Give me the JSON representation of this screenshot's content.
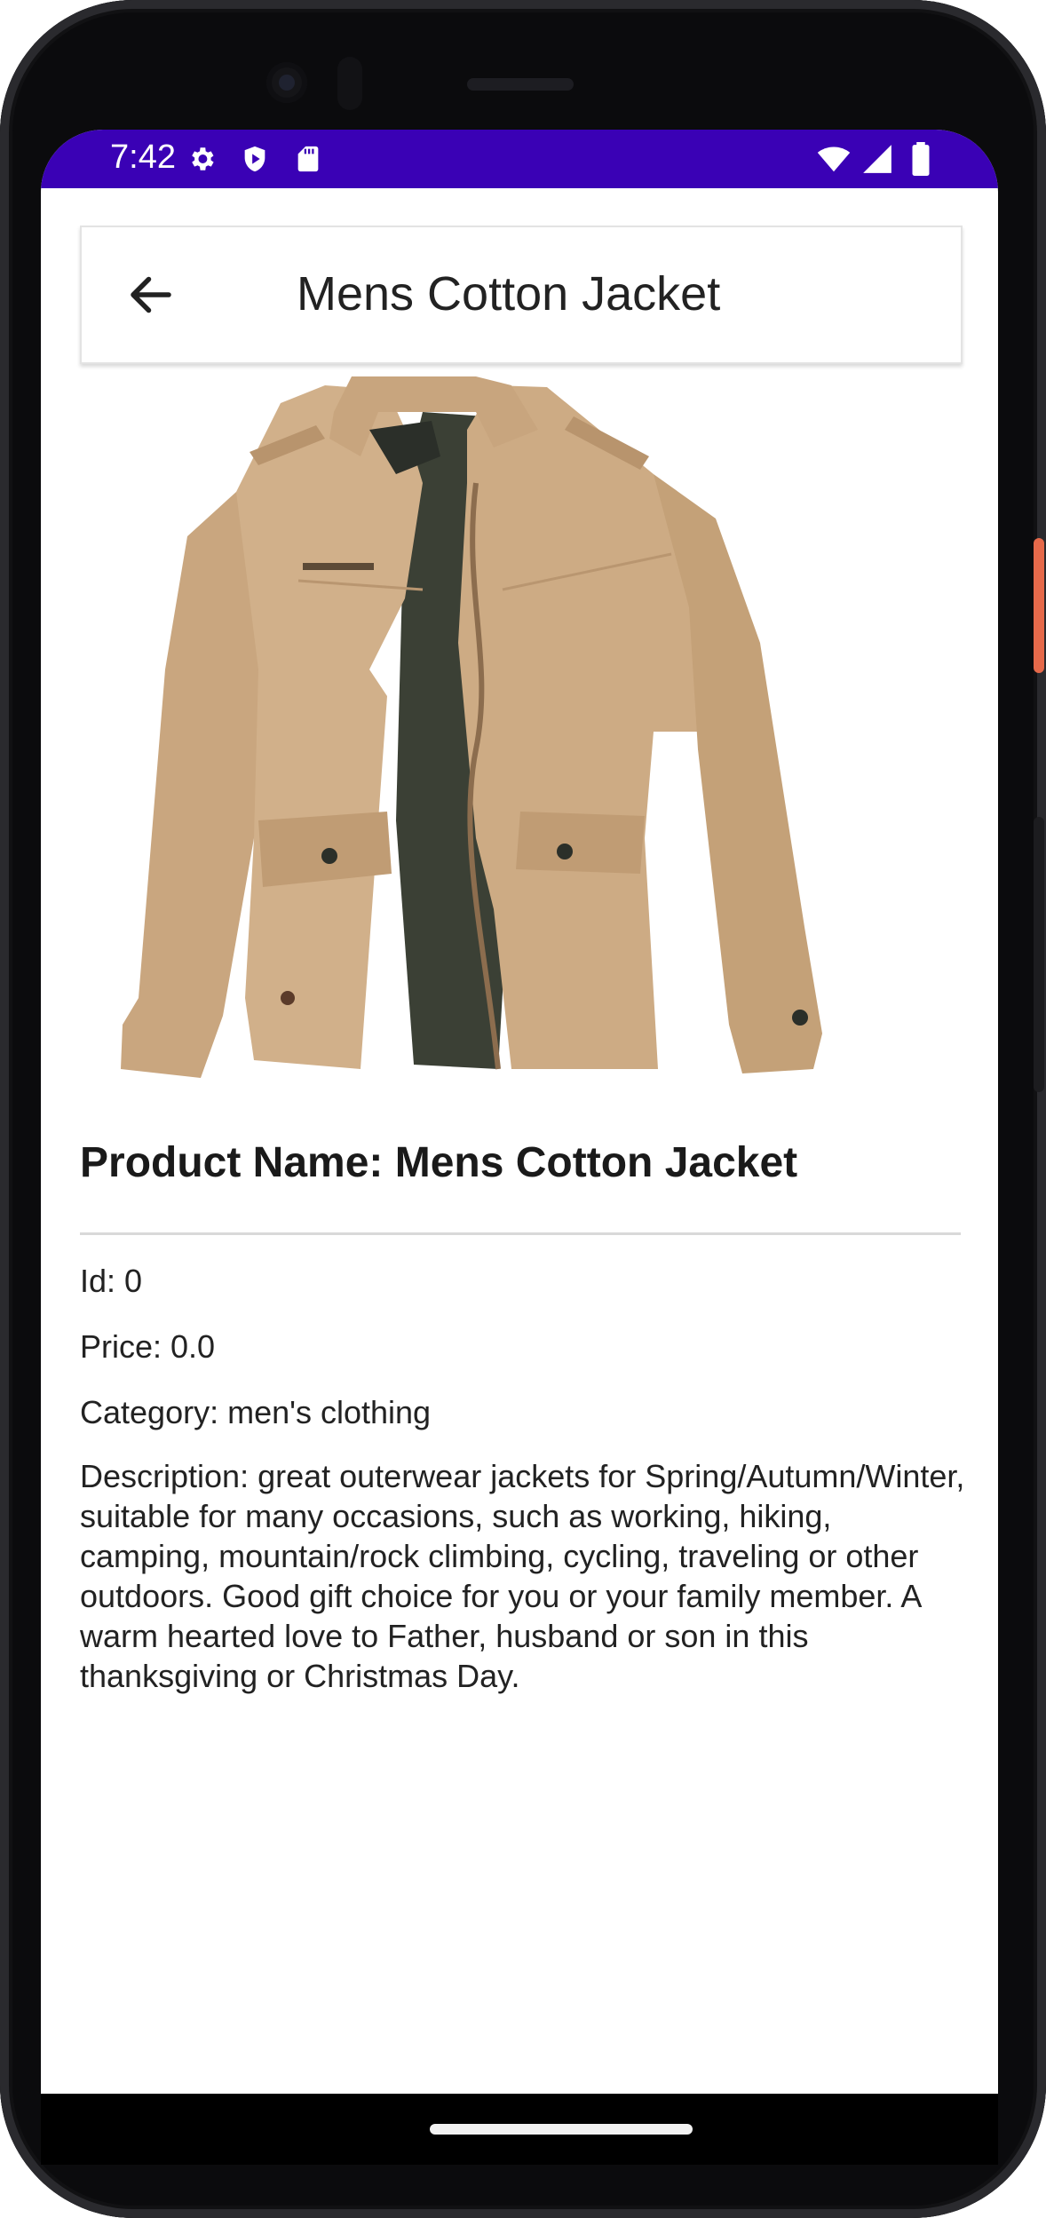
{
  "status_bar": {
    "time": "7:42",
    "background_color": "#3a01b5",
    "left_icons": [
      "gear-icon",
      "shield-play-icon",
      "sd-card-icon"
    ],
    "right_icons": [
      "wifi-icon",
      "cell-signal-icon",
      "battery-icon"
    ]
  },
  "app_bar": {
    "title": "Mens Cotton Jacket",
    "back_icon": "arrow-back-icon"
  },
  "product": {
    "image": "jacket-image",
    "name_line": "Product Name: Mens Cotton Jacket",
    "id_line": "Id: 0",
    "price_line": "Price: 0.0",
    "category_line": "Category: men's clothing",
    "description_line": "Description: great outerwear jackets for Spring/Autumn/Winter, suitable for many occasions, such as working, hiking, camping, mountain/rock climbing, cycling, traveling or other outdoors. Good gift choice for you or your family member. A warm hearted love to Father, husband or son in this thanksgiving or Christmas Day."
  }
}
